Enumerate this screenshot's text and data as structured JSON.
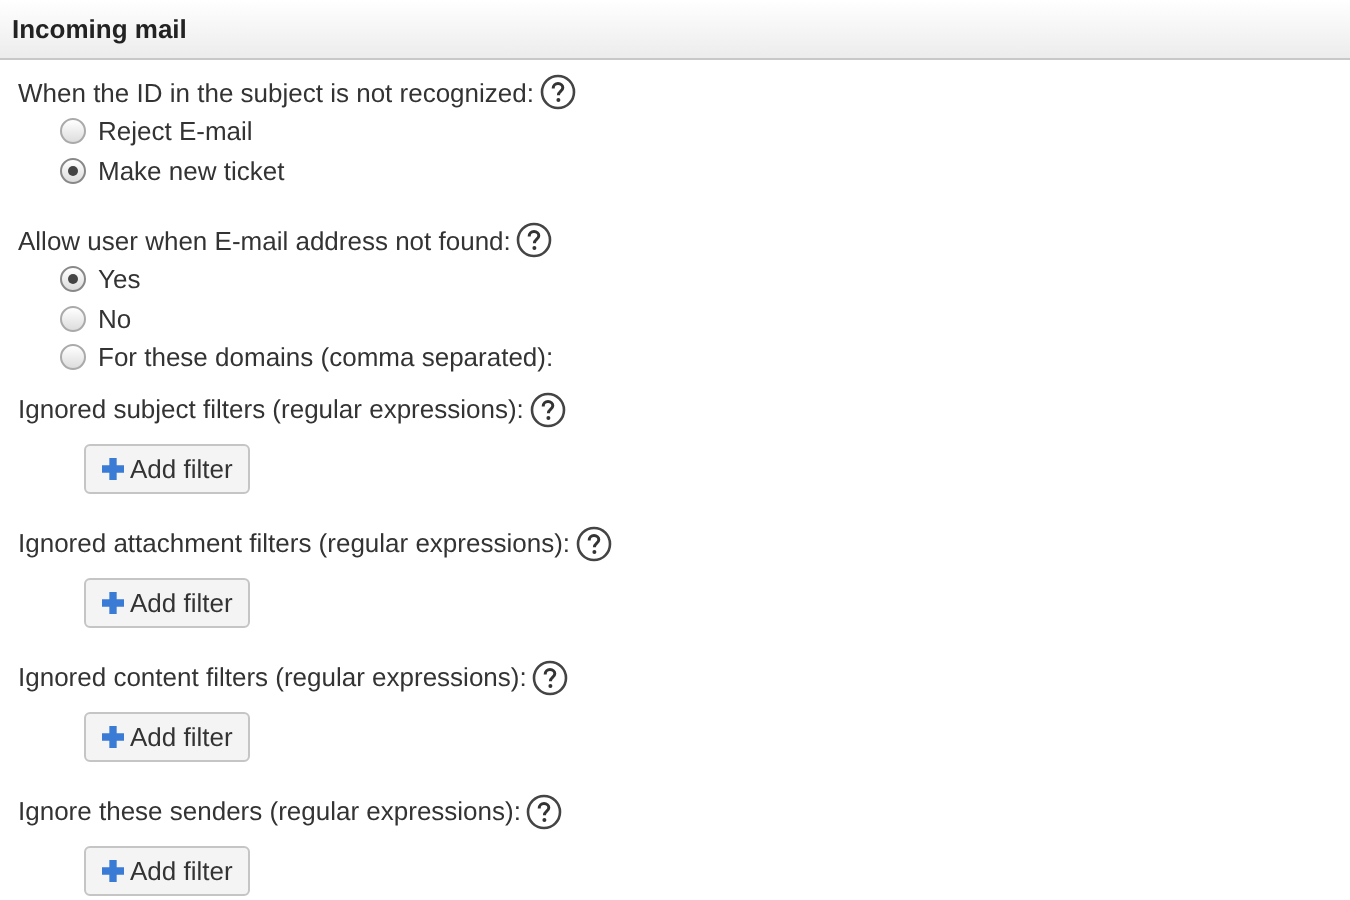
{
  "header": {
    "title": "Incoming mail"
  },
  "radio_groups": [
    {
      "question": "When the ID in the subject is not recognized:",
      "options": [
        {
          "label": "Reject E-mail",
          "selected": false
        },
        {
          "label": "Make new ticket",
          "selected": true
        }
      ]
    },
    {
      "question": "Allow user when E-mail address not found:",
      "options": [
        {
          "label": "Yes",
          "selected": true
        },
        {
          "label": "No",
          "selected": false
        },
        {
          "label": "For these domains (comma separated):",
          "selected": false
        }
      ]
    }
  ],
  "filters": [
    {
      "label": "Ignored subject filters (regular expressions):",
      "button": "Add filter"
    },
    {
      "label": "Ignored attachment filters (regular expressions):",
      "button": "Add filter"
    },
    {
      "label": "Ignored content filters (regular expressions):",
      "button": "Add filter"
    },
    {
      "label": "Ignore these senders (regular expressions):",
      "button": "Add filter"
    }
  ]
}
